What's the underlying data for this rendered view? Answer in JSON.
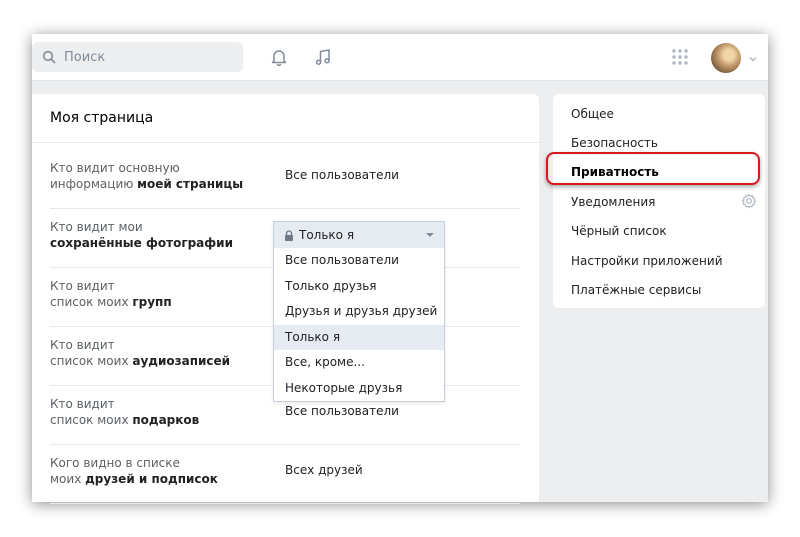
{
  "search": {
    "placeholder": "Поиск"
  },
  "icons": {
    "search": "search-icon",
    "notifications": "bell-icon",
    "music": "music-note-icon",
    "apps": "apps-grid-icon",
    "avatar": "avatar",
    "menu_caret": "chevron-down-icon",
    "lock": "lock-icon",
    "settings": "gear-icon"
  },
  "colors": {
    "accent_highlight": "#d7191e",
    "dropdown_selected_bg": "#e5ebf1",
    "page_bg": "#edeef0"
  },
  "panel": {
    "title": "Моя страница",
    "rows": [
      {
        "label_line1": "Кто видит основную",
        "label_line2_plain": "информацию ",
        "label_line2_bold": "моей страницы",
        "value": "Все пользователи"
      },
      {
        "label_line1": "Кто видит мои",
        "label_line2_plain": "",
        "label_line2_bold": "сохранённые фотографии",
        "value": ""
      },
      {
        "label_line1": "Кто видит",
        "label_line2_plain": "список моих ",
        "label_line2_bold": "групп",
        "value": ""
      },
      {
        "label_line1": "Кто видит",
        "label_line2_plain": "список моих ",
        "label_line2_bold": "аудиозаписей",
        "value": ""
      },
      {
        "label_line1": "Кто видит",
        "label_line2_plain": "список моих ",
        "label_line2_bold": "подарков",
        "value": "Все пользователи"
      },
      {
        "label_line1": "Кого видно в списке",
        "label_line2_plain": "моих ",
        "label_line2_bold": "друзей и подписок",
        "value": "Всех друзей"
      }
    ]
  },
  "dropdown": {
    "selected": "Только я",
    "options": [
      "Все пользователи",
      "Только друзья",
      "Друзья и друзья друзей",
      "Только я",
      "Все, кроме...",
      "Некоторые друзья"
    ],
    "active_index": 3
  },
  "menu": {
    "items": [
      "Общее",
      "Безопасность",
      "Приватность",
      "Уведомления",
      "Чёрный список",
      "Настройки приложений",
      "Платёжные сервисы"
    ],
    "active_index": 2
  }
}
